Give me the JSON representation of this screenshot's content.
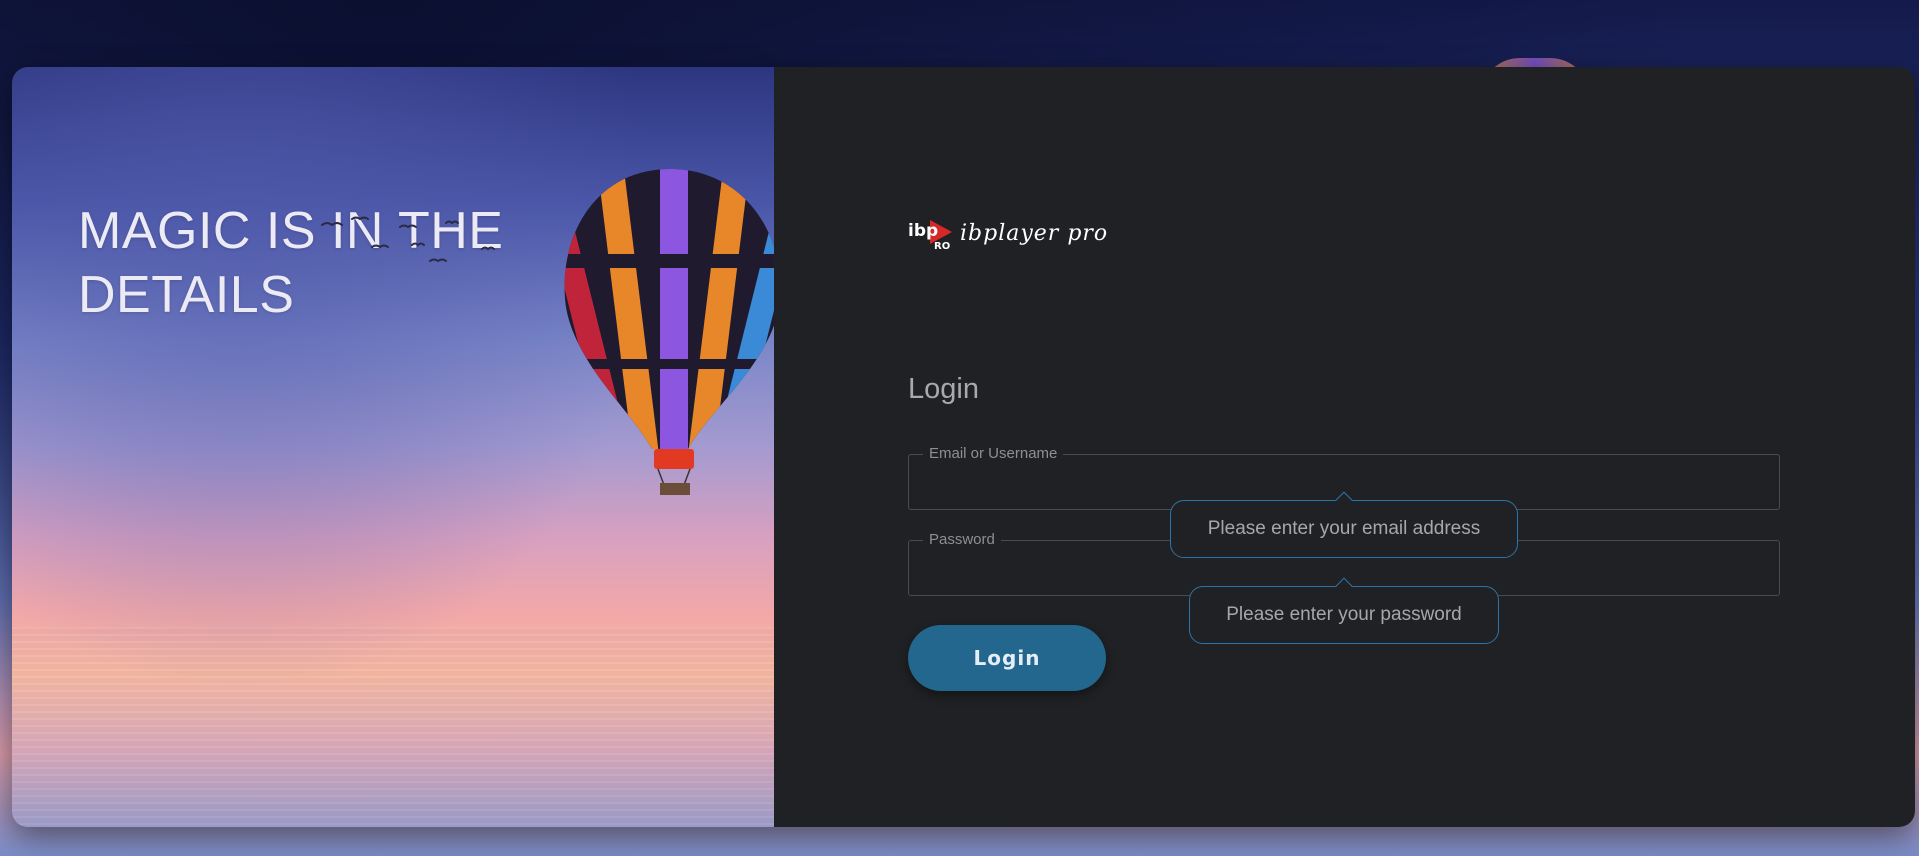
{
  "hero": {
    "title": "MAGIC IS IN THE DETAILS"
  },
  "brand": {
    "logo_mark": "ibp",
    "logo_sub": "RO",
    "name": "ibplayer pro",
    "accent_color": "#d62828"
  },
  "login": {
    "title": "Login",
    "email_label": "Email or Username",
    "email_value": "",
    "password_label": "Password",
    "password_value": "",
    "submit_label": "Login",
    "email_tooltip": "Please enter your email address",
    "password_tooltip": "Please enter your password"
  },
  "colors": {
    "panel_bg": "#202124",
    "button_bg": "#23678f",
    "tooltip_border": "#2e72a6"
  }
}
